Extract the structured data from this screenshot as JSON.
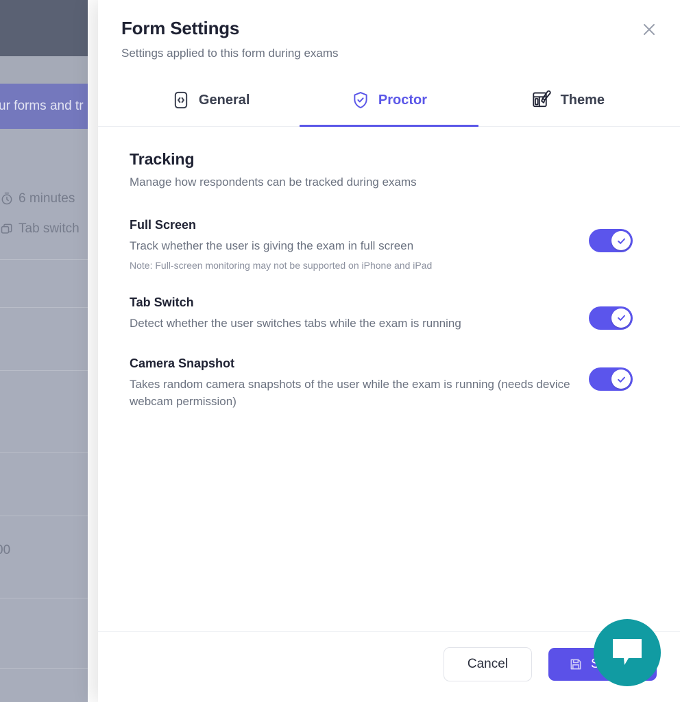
{
  "background": {
    "banner_text": "ur forms and tr",
    "meta": [
      {
        "icon": "stopwatch-icon",
        "label": "6 minutes"
      },
      {
        "icon": "tabs-icon",
        "label": "Tab switch"
      }
    ],
    "stray_value": "00"
  },
  "modal": {
    "title": "Form Settings",
    "subtitle": "Settings applied to this form during exams",
    "close_icon": "close-icon",
    "tabs": [
      {
        "label": "General",
        "icon": "code-brackets-icon",
        "active": false
      },
      {
        "label": "Proctor",
        "icon": "shield-check-icon",
        "active": true
      },
      {
        "label": "Theme",
        "icon": "palette-brush-icon",
        "active": false
      }
    ],
    "section": {
      "title": "Tracking",
      "subtitle": "Manage how respondents can be tracked during exams"
    },
    "settings": [
      {
        "name": "Full Screen",
        "description": "Track whether the user is giving the exam in full screen",
        "note": "Note: Full-screen monitoring may not be supported on iPhone and iPad",
        "enabled": true,
        "toggle_icon": "check-icon"
      },
      {
        "name": "Tab Switch",
        "description": "Detect whether the user switches tabs while the exam is running",
        "note": "",
        "enabled": true,
        "toggle_icon": "check-icon"
      },
      {
        "name": "Camera Snapshot",
        "description": "Takes random camera snapshots of the user while the exam is running (needs device webcam permission)",
        "note": "",
        "enabled": true,
        "toggle_icon": "check-icon"
      }
    ],
    "footer": {
      "cancel_label": "Cancel",
      "save_label": "Save",
      "save_icon": "floppy-disk-save-icon"
    }
  },
  "chat_widget": {
    "icon": "chat-bubble-icon",
    "color": "#119ba2"
  },
  "colors": {
    "accent": "#5b57e8",
    "save_button": "#5b51e8",
    "toggle_on": "#5b55ec",
    "title": "#1f2233",
    "muted_text": "#6b7280",
    "chat": "#119ba2"
  }
}
